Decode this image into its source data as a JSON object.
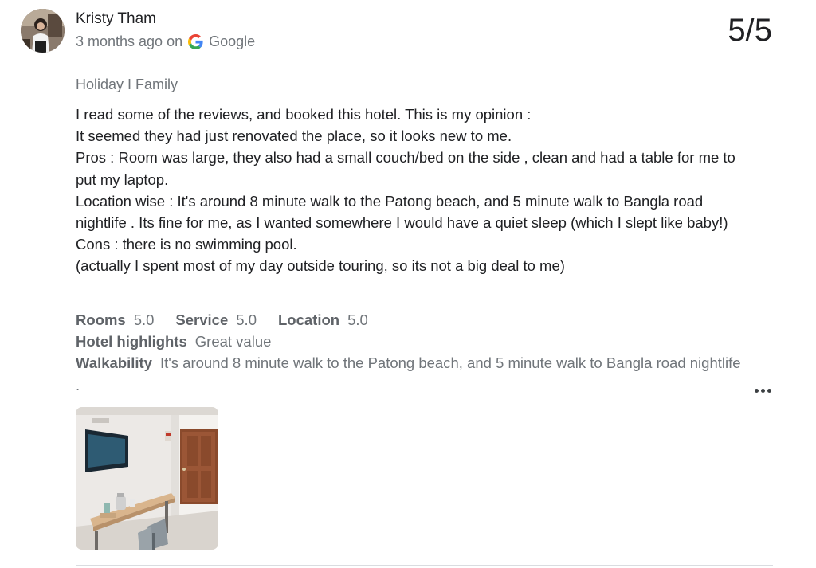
{
  "author": {
    "name": "Kristy Tham",
    "time": "3 months ago on",
    "source": "Google"
  },
  "score": "5/5",
  "trip_type": "Holiday I Family",
  "review_text": [
    "I read some of the reviews, and booked this hotel. This is my opinion :",
    "It seemed they had just renovated the place, so it looks new to me.",
    "Pros : Room was large, they also had a small couch/bed on the side , clean and had a table for me to put my laptop.",
    "Location wise : It's around 8 minute walk to the Patong beach, and 5 minute walk to Bangla road nightlife . Its fine for me, as I wanted somewhere I would have a quiet sleep (which I slept like baby!)",
    "Cons : there is no swimming pool.",
    "(actually I spent most of my day outside touring, so its not a big deal to me)"
  ],
  "ratings": {
    "rooms_label": "Rooms",
    "rooms_value": "5.0",
    "service_label": "Service",
    "service_value": "5.0",
    "location_label": "Location",
    "location_value": "5.0",
    "highlights_label": "Hotel highlights",
    "highlights_value": "Great value",
    "walkability_label": "Walkability",
    "walkability_value": "It's around 8 minute walk to the Patong beach, and 5 minute walk to Bangla road nightlife ."
  },
  "icons": {
    "more": "more-options-icon",
    "google": "google-g-icon",
    "avatar": "avatar"
  },
  "colors": {
    "text_primary": "#202124",
    "text_secondary": "#70757a",
    "google_blue": "#4285F4",
    "google_red": "#EA4335",
    "google_yellow": "#FBBC05",
    "google_green": "#34A853"
  }
}
